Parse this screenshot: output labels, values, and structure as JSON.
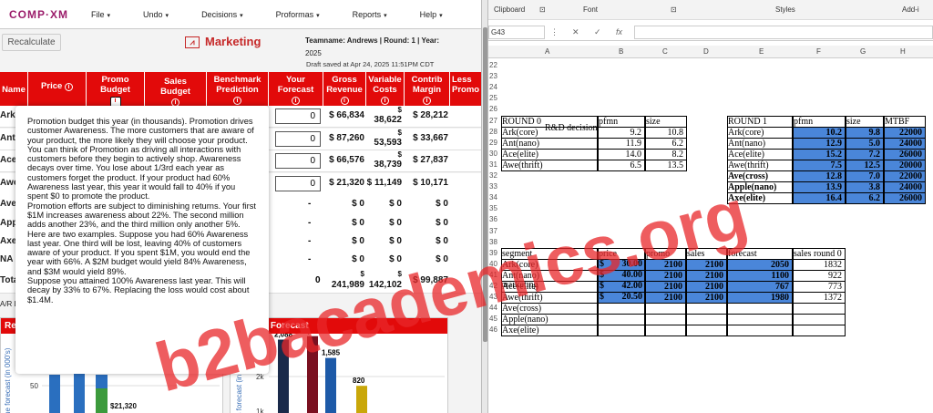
{
  "app": {
    "logo": "COMP·XM",
    "menus": [
      "File",
      "Undo",
      "Decisions",
      "Proformas",
      "Reports",
      "Help"
    ],
    "recalculate": "Recalculate",
    "page_title": "Marketing",
    "team_line1": "Teamname: Andrews | Round: 1 | Year:",
    "team_line2": "2025",
    "draft": "Draft saved at Apr 24, 2025 11:51PM CDT"
  },
  "table": {
    "headers": [
      "Name",
      "Price",
      "Promo Budget",
      "Sales Budget",
      "Benchmark Prediction",
      "Your Forecast",
      "Gross Revenue",
      "Variable Costs",
      "Contrib Margin",
      "Less Promo"
    ],
    "rows": [
      {
        "name": "Ark",
        "forecast": "0",
        "gross": "$ 66,834",
        "var_top": "$",
        "var": "38,622",
        "contrib": "$ 28,212"
      },
      {
        "name": "Ant",
        "forecast": "0",
        "gross": "$ 87,260",
        "var_top": "$",
        "var": "53,593",
        "contrib": "$ 33,667"
      },
      {
        "name": "Ace",
        "forecast": "0",
        "gross": "$ 66,576",
        "var_top": "$",
        "var": "38,739",
        "contrib": "$ 27,837"
      },
      {
        "name": "Awe",
        "forecast": "0",
        "gross": "$ 21,320",
        "var_top": "",
        "var": "$ 11,149",
        "contrib": "$ 10,171"
      },
      {
        "name": "Ave",
        "dash": "-",
        "gross": "$ 0",
        "var": "$ 0",
        "contrib": "$ 0"
      },
      {
        "name": "Apple",
        "dash": "-",
        "gross": "$ 0",
        "var": "$ 0",
        "contrib": "$ 0"
      },
      {
        "name": "Axe",
        "dash": "-",
        "gross": "$ 0",
        "var": "$ 0",
        "contrib": "$ 0"
      },
      {
        "name": "NA",
        "dash": "-",
        "gross": "$ 0",
        "var": "$ 0",
        "contrib": "$ 0"
      },
      {
        "name": "Total",
        "dash": "0",
        "gross_top": "$",
        "gross": "241,989",
        "var_top": "$",
        "var": "142,102",
        "contrib": "$ 99,887"
      }
    ]
  },
  "ar_label": "A/R La",
  "tooltip": [
    "Promotion budget this year (in thousands). Promotion drives customer Awareness. The more customers that are aware of your product, the more likely they will choose your product. You can think of Promotion as driving all interactions with customers before they begin to actively shop. Awareness decays over time. You lose about 1/3rd each year as customers forget the product. If your product had 60% Awareness last year, this year it would fall to 40% if you spent $0 to promote the product.",
    "Promotion efforts are subject to diminishing returns. Your first $1M increases awareness about 22%. The second million adds another 23%, and the third million only another 5%.",
    "Here are two examples. Suppose you had 60% Awareness last year. One third will be lost, leaving 40% of customers aware of your product. If you spent $1M, you would end the year with 66%. A $2M budget would yield 84% Awareness, and $3M would yield 89%.",
    "Suppose you attained 100% Awareness last year. This will decay by 33% to 67%. Replacing the loss would cost about $1.4M."
  ],
  "charts": {
    "left_title": "Rev",
    "left_axis": "ue forecast (in 000's)",
    "left_tick": "50",
    "left_value": "$21,320",
    "right_title": "es Forecast",
    "right_axis": "es forecast (in",
    "right_ticks": [
      "2k",
      "1k"
    ],
    "bar_values": [
      {
        "label": "2,088",
        "value": 2088
      },
      {
        "label": "2,182",
        "value": 2182
      },
      {
        "label": "1,585",
        "value": 1585
      },
      {
        "label": "820",
        "value": 820
      }
    ]
  },
  "excel": {
    "ribbon": [
      "Clipboard",
      "Font",
      "Styles",
      "Add-i"
    ],
    "namebox": "G43",
    "fbuttons": [
      "⋮",
      "✕",
      "✓",
      "fx"
    ],
    "columns": [
      "A",
      "B",
      "C",
      "D",
      "E",
      "F",
      "G",
      "H"
    ],
    "rows": [
      "22",
      "23",
      "24",
      "25",
      "26",
      "27",
      "28",
      "29",
      "30",
      "31",
      "32",
      "33",
      "34",
      "35",
      "36",
      "37",
      "38",
      "39",
      "40",
      "41",
      "42",
      "43",
      "44",
      "45",
      "46"
    ],
    "rd_title": "R&D decision",
    "round0": {
      "header": [
        "ROUND 0",
        "pfmn",
        "size"
      ],
      "rows": [
        [
          "Ark(core)",
          "9.2",
          "10.8"
        ],
        [
          "Ant(nano)",
          "11.9",
          "6.2"
        ],
        [
          "Ace(elite)",
          "14.0",
          "8.2"
        ],
        [
          "Awe(thrift)",
          "6.5",
          "13.5"
        ]
      ]
    },
    "round1": {
      "header": [
        "ROUND 1",
        "pfmn",
        "size",
        "MTBF"
      ],
      "rows": [
        [
          "Ark(core)",
          "10.2",
          "9.8",
          "22000"
        ],
        [
          "Ant(nano)",
          "12.9",
          "5.0",
          "24000"
        ],
        [
          "Ace(elite)",
          "15.2",
          "7.2",
          "26000"
        ],
        [
          "Awe(thrift)",
          "7.5",
          "12.5",
          "20000"
        ],
        [
          "Ave(cross)",
          "12.8",
          "7.0",
          "22000"
        ],
        [
          "Apple(nano)",
          "13.9",
          "3.8",
          "24000"
        ],
        [
          "Axe(elite)",
          "16.4",
          "6.2",
          "26000"
        ]
      ]
    },
    "marketing_title": "marketing",
    "marketing": {
      "header": [
        "segment",
        "price",
        "promo",
        "sales",
        "forecast",
        "sales round 0"
      ],
      "rows": [
        [
          "Ark(core)",
          "$",
          "30.00",
          "2100",
          "2100",
          "2050",
          "1832"
        ],
        [
          "Ant(nano)",
          "$",
          "40.00",
          "2100",
          "2100",
          "1100",
          "922"
        ],
        [
          "Ace(elite)",
          "$",
          "42.00",
          "2100",
          "2100",
          "767",
          "773"
        ],
        [
          "Awe(thrift)",
          "$",
          "20.50",
          "2100",
          "2100",
          "1980",
          "1372"
        ],
        [
          "Ave(cross)",
          "",
          "",
          "",
          "",
          "",
          ""
        ],
        [
          "Apple(nano)",
          "",
          "",
          "",
          "",
          "",
          ""
        ],
        [
          "Axe(elite)",
          "",
          "",
          "",
          "",
          "",
          ""
        ]
      ]
    }
  },
  "watermark": "b2bacademics.org",
  "colors": {
    "red": "#e20a0a",
    "blue": "#4a86d9",
    "watermark": "#e8272a"
  }
}
